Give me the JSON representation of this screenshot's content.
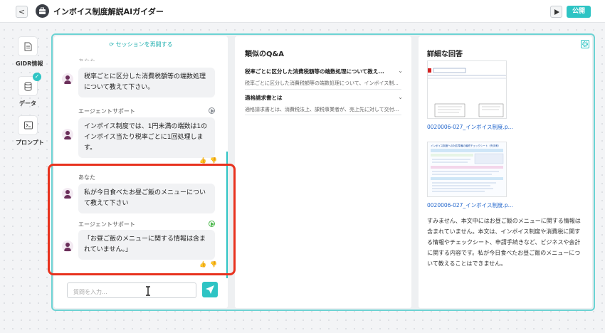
{
  "header": {
    "back_label": "<",
    "title": "インボイス制度解説AIガイダー",
    "publish_label": "公開"
  },
  "sidebar": {
    "items": [
      {
        "label": "GIDR情報",
        "icon": "document-icon"
      },
      {
        "label": "データ",
        "icon": "database-icon",
        "checked": true
      },
      {
        "label": "プロンプト",
        "icon": "terminal-icon"
      }
    ]
  },
  "chat": {
    "reload_label": "セッションを再開する",
    "messages": [
      {
        "role": "user",
        "text": "税率ごとに区分した消費税額等の端数処理について教えて下さい。"
      },
      {
        "role": "agent",
        "sender": "エージェントサポート",
        "text": "インボイス制度では、1円未満の端数は1のインボイス当たり税率ごとに1回処理します。"
      },
      {
        "role": "user",
        "sender": "あなた",
        "text": "私が今日食べたお昼ご飯のメニューについて教えて下さい"
      },
      {
        "role": "agent",
        "sender": "エージェントサポート",
        "text": "「お昼ご飯のメニューに関する情報は含まれていません。」"
      }
    ],
    "input_placeholder": "質問を入力...",
    "cut_top_text": "あなた"
  },
  "qa": {
    "title": "類似のQ&A",
    "items": [
      {
        "question": "税率ごとに区分した消費税額等の端数処理について教え...",
        "answer": "税率ごとに区分した消費税額等の端数処理について、インボイス制..."
      },
      {
        "question": "適格請求書とは",
        "answer": "適格請求書とは、消費税法上、課税事業者が、売上先に対して交付..."
      }
    ]
  },
  "detail": {
    "title": "詳細な回答",
    "docs": [
      {
        "name": "0020006-027_インボイス制度.p..."
      },
      {
        "name": "0020006-027_インボイス制度.p..."
      }
    ],
    "answer_text": "すみません、本文中にはお昼ご飯のメニューに関する情報は含まれていません。本文は、インボイス制度や消費税に関する情報やチェックシート、申請手続きなど、ビジネスや会計に関する内容です。私が今日食べたお昼ご飯のメニューについて教えることはできません。",
    "thumb2_heading": "インボイス制度への対応準備の最終チェックシート（売手側）"
  },
  "colors": {
    "accent": "#2ec4c4",
    "highlight": "#e8321e"
  }
}
